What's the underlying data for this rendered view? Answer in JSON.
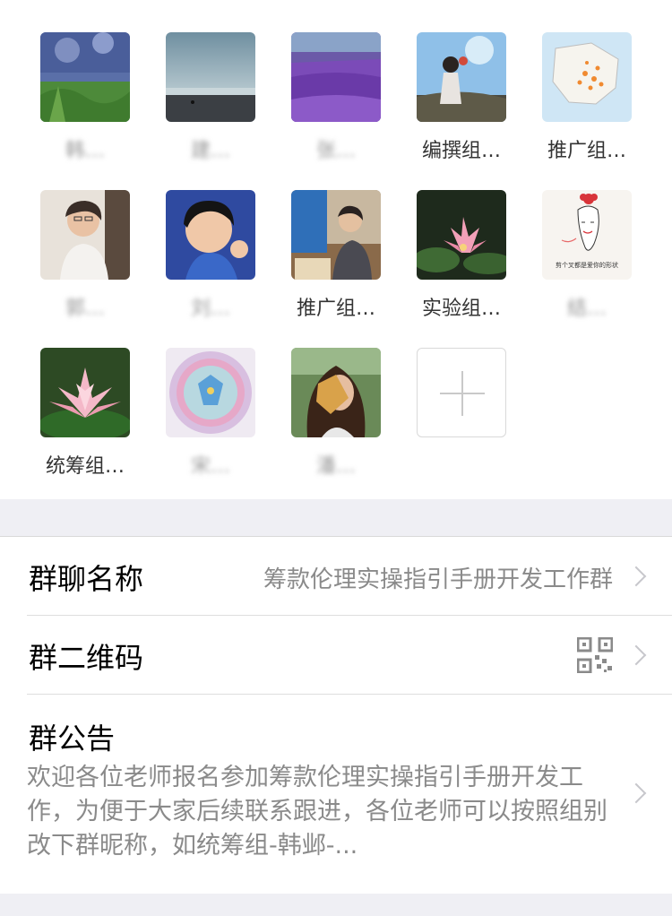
{
  "members": [
    {
      "name": "韩…",
      "redacted": true
    },
    {
      "name": "建…",
      "redacted": true
    },
    {
      "name": "张…",
      "redacted": true
    },
    {
      "name": "编撰组…",
      "redacted": false
    },
    {
      "name": "推广组…",
      "redacted": false
    },
    {
      "name": "郭…",
      "redacted": true
    },
    {
      "name": "刘…",
      "redacted": true
    },
    {
      "name": "推广组…",
      "redacted": false
    },
    {
      "name": "实验组…",
      "redacted": false
    },
    {
      "name": "结…",
      "redacted": true
    },
    {
      "name": "统筹组…",
      "redacted": false
    },
    {
      "name": "宋…",
      "redacted": true
    },
    {
      "name": "潘…",
      "redacted": true
    }
  ],
  "avatar_caption_9": "剪个叉都是爱你的形状",
  "settings": {
    "group_name_label": "群聊名称",
    "group_name_value": "筹款伦理实操指引手册开发工作群",
    "qr_label": "群二维码",
    "announcement_label": "群公告",
    "announcement_text": "欢迎各位老师报名参加筹款伦理实操指引手册开发工作，为便于大家后续联系跟进，各位老师可以按照组别改下群昵称，如统筹组-韩邺-..."
  },
  "icons": {
    "add": "plus-icon",
    "chevron": "chevron-right-icon",
    "qr": "qr-code-icon"
  }
}
